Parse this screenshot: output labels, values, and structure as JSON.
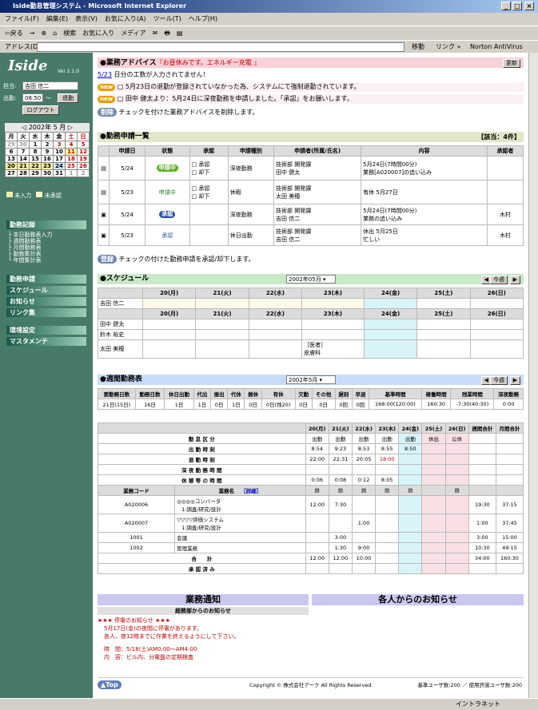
{
  "window": {
    "title": "Iside勤怠管理システム - Microsoft Internet Explorer",
    "min": "_",
    "max": "□",
    "close": "×"
  },
  "menu": [
    "ファイル(F)",
    "編集(E)",
    "表示(V)",
    "お気に入り(A)",
    "ツール(T)",
    "ヘルプ(H)"
  ],
  "toolbar": [
    "⇦戻る",
    "→",
    "⊗",
    "⌂",
    "検索",
    "お気に入り",
    "メディア",
    "✉",
    "🖶",
    "▤"
  ],
  "address": {
    "label": "アドレス(D)",
    "value": "",
    "go": "移動",
    "links": "リンク »",
    "av": "Norton AntiVirus"
  },
  "status": {
    "left": "",
    "zone": "イントラネット"
  },
  "side": {
    "logo": "Iside",
    "version": "Ver 2.1.0",
    "user_label": "担当:",
    "user": "吉田 信二",
    "time_label": "出勤:",
    "time": "08:50",
    "tilde": "〜",
    "clockout": "退勤",
    "logout": "ログアウト",
    "cal_title": "2002年 5 月",
    "cal_head": [
      "月",
      "火",
      "水",
      "木",
      "金",
      "土",
      "日"
    ],
    "cal_rows": [
      [
        "29",
        "30",
        "1",
        "2",
        "3",
        "4",
        "5"
      ],
      [
        "6",
        "7",
        "8",
        "9",
        "10",
        "11",
        "12"
      ],
      [
        "13",
        "14",
        "15",
        "16",
        "17",
        "18",
        "19"
      ],
      [
        "20",
        "21",
        "22",
        "23",
        "24",
        "25",
        "26"
      ],
      [
        "27",
        "28",
        "29",
        "30",
        "31",
        "1",
        "2"
      ]
    ],
    "legend_unentered": "未入力",
    "legend_unapproved": "未承認",
    "nav1": "勤務記録",
    "subs": [
      "本日勤務表入力",
      "週間勤務表",
      "月間勤務表",
      "勤務集計表",
      "年間集計表"
    ],
    "nav2": [
      "勤務申請",
      "スケジュール",
      "お知らせ",
      "リンク集"
    ],
    "nav3": [
      "環境設定",
      "マスタメンテ"
    ]
  },
  "advice": {
    "title": "●業務アドバイス",
    "subtitle": "『お昼休みです。エネルギー充電 』",
    "update": "更新",
    "line1_date": "5/23",
    "line1": " 日分の工数が入力されてません！",
    "line2": "5月23日の退勤が登録されていなかった為、システムにて強制退勤されています。",
    "line3": "田中 健太より：5月24日に深夜勤務を申請しました。「承認」をお願いします。",
    "delete": "削除",
    "delete_note": "チェックを付けた業務アドバイスを削除します。"
  },
  "apps": {
    "title": "●勤務申請一覧",
    "count": "【該当：4件】",
    "headers": [
      "申請日",
      "状態",
      "承認",
      "申請種別",
      "申請者(所属/氏名)",
      "内容",
      "承認者"
    ],
    "rows": [
      {
        "date": "5/24",
        "status": "申請中",
        "approve": "□ 承認",
        "reject": "□ 却下",
        "type": "深夜勤務",
        "dept": "技術部 開発課",
        "name": "田中 健太",
        "c1": "5月24日(7時間00分)",
        "c2": "業務[A020007]の追い込み",
        "approver": ""
      },
      {
        "date": "5/23",
        "status": "申請中",
        "approve": "□ 承認",
        "reject": "□ 却下",
        "type": "休暇",
        "dept": "技術部 開発課",
        "name": "太田 美穂",
        "c1": "有休 5月27日",
        "c2": "",
        "approver": ""
      },
      {
        "date": "5/24",
        "status": "承認",
        "approve": "",
        "reject": "",
        "type": "深夜勤務",
        "dept": "技術部 開発課",
        "name": "吉田 信二",
        "c1": "5月24日(7時間00分)",
        "c2": "業務の追い込み",
        "approver": "木村"
      },
      {
        "date": "5/23",
        "status": "承認",
        "approve": "",
        "reject": "",
        "type": "休日出勤",
        "dept": "技術部 開発課",
        "name": "吉田 信二",
        "c1": "休出 5月25日",
        "c2": "忙しい",
        "approver": "木村"
      }
    ],
    "register": "登録",
    "register_note": "チェックの付けた勤務申請を承認/却下します。"
  },
  "sched": {
    "title": "●スケジュール",
    "month": "2002年05月",
    "today": "今週",
    "days": [
      "20(月)",
      "21(火)",
      "22(水)",
      "23(木)",
      "24(金)",
      "25(土)",
      "26(日)"
    ],
    "me": "吉田 信二",
    "others": [
      "田中 健太",
      "鈴木 裕史",
      "太田 美穂"
    ],
    "note1": "［医者］",
    "note2": "皮膚科"
  },
  "weekly": {
    "title": "●週間勤務表",
    "month": "2002年5月",
    "today": "今週",
    "sum_head": [
      "要勤務日数",
      "勤務日数",
      "休日出勤",
      "代出",
      "振出",
      "代休",
      "振休",
      "有休",
      "欠勤",
      "その他",
      "遅刻",
      "早退",
      "基準時間",
      "稼働時間",
      "残業時間",
      "深夜勤務"
    ],
    "sum_val": [
      "21日(15日)",
      "16日",
      "1日",
      "1日",
      "0日",
      "1日",
      "0日",
      "0日(残20)",
      "0日",
      "0日",
      "0回",
      "0回",
      "168:00(120:00)",
      "160:30",
      "-7:30(40:30)",
      "0:00"
    ],
    "day_head": [
      "20(月)",
      "21(火)",
      "22(水)",
      "23(木)",
      "24(金)",
      "25(土)",
      "26(日)",
      "週間合計",
      "月間合計"
    ],
    "labels": [
      "勤 怠 区 分",
      "出 勤 時 刻",
      "退 勤 時 刻",
      "深 夜 勤 務 時 間",
      "休 憩 等 の 時 間"
    ],
    "kubun": [
      "出勤",
      "出勤",
      "出勤",
      "出勤",
      "出勤",
      "休出",
      "公休",
      "",
      ""
    ],
    "in": [
      "8:54",
      "9:23",
      "8:53",
      "8:55",
      "8:50",
      "",
      "",
      "",
      ""
    ],
    "out": [
      "22:00",
      "22:31",
      "20:05",
      "18:00",
      "",
      "",
      "",
      "",
      ""
    ],
    "night": [
      "",
      "",
      "",
      "",
      "",
      "",
      "",
      "",
      ""
    ],
    "rest": [
      "0:06",
      "0:08",
      "0:12",
      "8:05",
      "",
      "",
      "",
      "",
      ""
    ],
    "code_h": "業務コード",
    "name_h": "業務名",
    "detail": "［詳細］",
    "tasks": [
      {
        "code": "A020006",
        "name": "◎◎◎◎コンバータ",
        "sub": "1:調査/研究/設計",
        "v": [
          "12:00",
          "7:30",
          "",
          "",
          "",
          "",
          "",
          "19:30",
          "37:15"
        ]
      },
      {
        "code": "A020007",
        "name": "▽▽▽▽評価システム",
        "sub": "1:調査/研究/設計",
        "v": [
          "",
          "",
          "1:00",
          "",
          "",
          "",
          "",
          "1:00",
          "37:45"
        ]
      },
      {
        "code": "1001",
        "name": "会議",
        "sub": "",
        "v": [
          "",
          "3:00",
          "",
          "",
          "",
          "",
          "",
          "3:00",
          "15:00"
        ]
      },
      {
        "code": "1002",
        "name": "管理業務",
        "sub": "",
        "v": [
          "",
          "1:30",
          "9:00",
          "",
          "",
          "",
          "",
          "10:30",
          "49:15"
        ]
      }
    ],
    "total_label": "合　　計",
    "total": [
      "12:00",
      "12:00",
      "10:00",
      "",
      "",
      "",
      "",
      "34:00",
      "160:30"
    ],
    "approved_label": "承 認 済 み"
  },
  "notice": {
    "left_title": "業務通知",
    "right_title": "各人からのお知らせ",
    "sub": "総務部からのお知らせ",
    "head": "★★★ 停電のお知らせ ★★★",
    "l1": "5月17日(金)の夜間に停電があります。",
    "l2": "各人、夜12時までに作業を終えるようにして下さい。",
    "l3": "時　間：5/18(土)AM0:00～AM4:00",
    "l4": "内　容：ビル内、分電盤の定期検査"
  },
  "footer": {
    "top": "▲Top",
    "copy": "Copyright © 株式会社アーク All Rights Reserved.",
    "users": "基準ユーザ数:200 ／ 使用許諾ユーザ数:200"
  }
}
